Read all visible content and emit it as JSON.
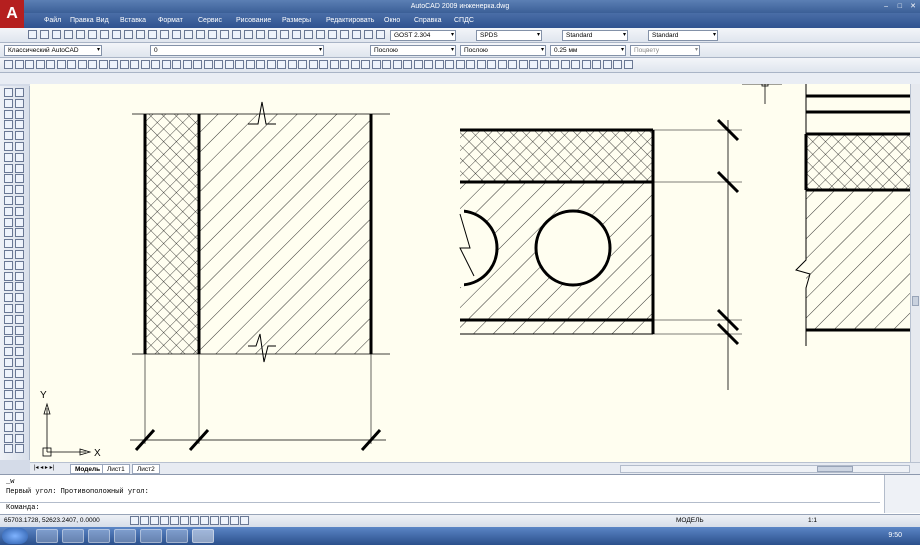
{
  "window": {
    "title": "AutoCAD 2009 инженерка.dwg"
  },
  "menu": [
    "Файл",
    "Правка",
    "Вид",
    "Вставка",
    "Формат",
    "Сервис",
    "Рисование",
    "Размеры",
    "Редактировать",
    "Окно",
    "Справка",
    "СПДС"
  ],
  "toolbar": {
    "text_style": "GOST 2.304",
    "dim_style": "SPDS",
    "table_style": "Standard",
    "multileader_style": "Standard",
    "workspace": "Классический AutoCAD",
    "layer": "0",
    "color": "Послою",
    "linetype": "Послою",
    "lineweight": "0.25 мм",
    "plotstyle": "Поцвету"
  },
  "layout_tabs": [
    "Модель",
    "Лист1",
    "Лист2"
  ],
  "ucs": {
    "x_label": "X",
    "y_label": "Y"
  },
  "command": {
    "history1": "_w",
    "history2": "Первый угол: Противоположный угол:",
    "prompt": "Команда:"
  },
  "status": {
    "coords": "65703.1728, 52623.2407, 0.0000",
    "model": "МОДЕЛЬ",
    "scale": "1:1"
  },
  "taskbar": {
    "clock": "9:50"
  },
  "colors": {
    "canvas": "#fffef0",
    "accent": "#b51f1f"
  }
}
